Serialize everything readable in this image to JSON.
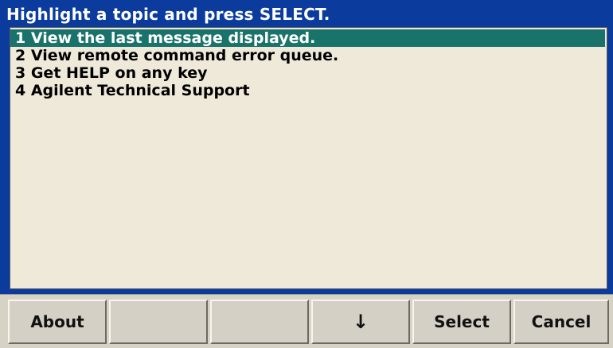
{
  "title": "Highlight a topic and press SELECT.",
  "items": [
    {
      "label": "1 View the last message displayed.",
      "selected": true
    },
    {
      "label": "2 View remote command error queue.",
      "selected": false
    },
    {
      "label": "3 Get HELP on any key",
      "selected": false
    },
    {
      "label": "4 Agilent Technical Support",
      "selected": false
    }
  ],
  "softkeys": {
    "about": "About",
    "blank1": "",
    "blank2": "",
    "down_arrow": "↓",
    "select": "Select",
    "cancel": "Cancel"
  },
  "icons": {
    "down_arrow": "arrow-down-icon"
  },
  "colors": {
    "frame": "#0c3b9e",
    "content_bg": "#efe9da",
    "highlight": "#19736b",
    "softkey_bg": "#d4d0c5"
  }
}
